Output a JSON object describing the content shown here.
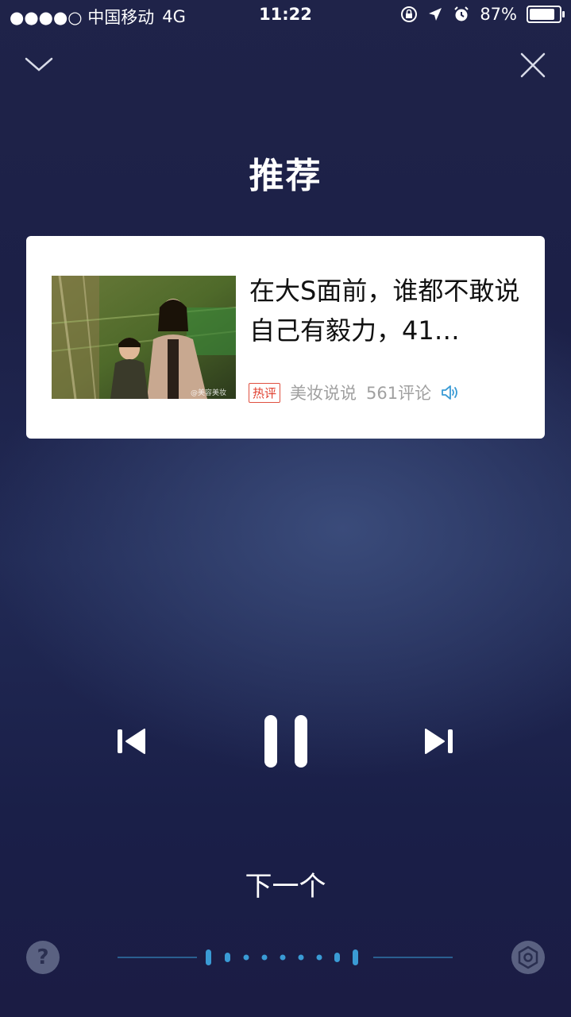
{
  "status_bar": {
    "carrier": "●●●●○ 中国移动",
    "network": "4G",
    "time": "11:22",
    "battery_percent": "87%",
    "battery_level": 0.87
  },
  "header": {
    "title": "推荐"
  },
  "card": {
    "title": "在大S面前，谁都不敢说自己有毅力，41…",
    "tag": "热评",
    "source": "美妆说说",
    "comments": "561评论",
    "thumbnail_caption": "@美容美妆"
  },
  "player": {
    "next_label": "下一个",
    "state": "playing"
  },
  "bottom": {
    "help_label": "?"
  },
  "colors": {
    "accent": "#3a9bd5",
    "tag_red": "#e04030"
  }
}
